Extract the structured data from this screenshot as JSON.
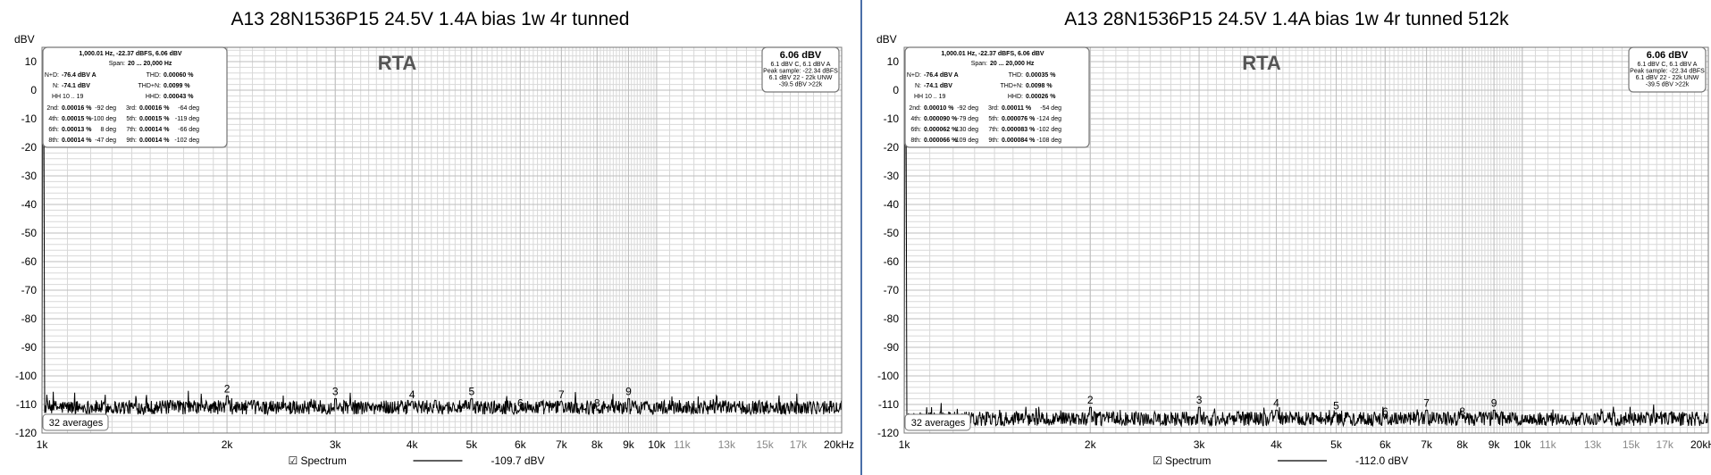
{
  "chart_data": [
    {
      "type": "line",
      "title": "A13 28N1536P15 24.5V 1.4A bias 1w 4r tunned",
      "ylabel": "dBV",
      "overlay_label": "RTA",
      "xscale": "log",
      "xlim": [
        1000,
        20000
      ],
      "ylim": [
        -120,
        15
      ],
      "x_ticks": [
        "1k",
        "2k",
        "3k",
        "4k",
        "5k",
        "6k",
        "7k",
        "8k",
        "9k",
        "10k",
        "11k",
        "13k",
        "15k",
        "17k",
        "20kHz"
      ],
      "y_ticks": [
        "10",
        "0",
        "-10",
        "-20",
        "-30",
        "-40",
        "-50",
        "-60",
        "-70",
        "-80",
        "-90",
        "-100",
        "-110",
        "-120"
      ],
      "grid": true,
      "legend": {
        "position": "bottom",
        "checkbox": "☑",
        "series_name": "Spectrum",
        "level": "-109.7 dBV"
      },
      "averages": "32 averages",
      "noise_floor_dBV": -111,
      "fundamental": {
        "freq_hz": 1000,
        "level_dBV": 6.06
      },
      "harmonics": [
        {
          "label": "2",
          "freq_hz": 2000,
          "level_dBV": -107
        },
        {
          "label": "3",
          "freq_hz": 3000,
          "level_dBV": -108
        },
        {
          "label": "4",
          "freq_hz": 4000,
          "level_dBV": -109
        },
        {
          "label": "5",
          "freq_hz": 5000,
          "level_dBV": -108
        },
        {
          "label": "6",
          "freq_hz": 6000,
          "level_dBV": -112
        },
        {
          "label": "7",
          "freq_hz": 7000,
          "level_dBV": -109
        },
        {
          "label": "8",
          "freq_hz": 8000,
          "level_dBV": -112
        },
        {
          "label": "9",
          "freq_hz": 9000,
          "level_dBV": -108
        }
      ],
      "stats_box": {
        "header": "1,000.01 Hz, -22.37 dBFS, 6.06 dBV",
        "span_label": "Span:",
        "span_value": "20 ... 20,000 Hz",
        "nd_label": "N+D:",
        "nd_value": "-76.4 dBV A",
        "thd_label": "THD:",
        "thd_value": "0.00060 %",
        "n_label": "N:",
        "n_value": "-74.1 dBV",
        "thdn_label": "THD+N:",
        "thdn_value": "0.0099 %",
        "hh_label": "HH 10 .. 19",
        "hhd_label": "HHD:",
        "hhd_value": "0.00043 %",
        "rows": [
          {
            "a_label": "2nd:",
            "a_val": "0.00016 %",
            "a_deg": "-92 deg",
            "b_label": "3rd:",
            "b_val": "0.00016 %",
            "b_deg": "-64 deg"
          },
          {
            "a_label": "4th:",
            "a_val": "0.00015 %",
            "a_deg": "-100 deg",
            "b_label": "5th:",
            "b_val": "0.00015 %",
            "b_deg": "-119 deg"
          },
          {
            "a_label": "6th:",
            "a_val": "0.00013 %",
            "a_deg": "8 deg",
            "b_label": "7th:",
            "b_val": "0.00014 %",
            "b_deg": "-66 deg"
          },
          {
            "a_label": "8th:",
            "a_val": "0.00014 %",
            "a_deg": "-47 deg",
            "b_label": "9th:",
            "b_val": "0.00014 %",
            "b_deg": "-102 deg"
          }
        ]
      },
      "level_box": {
        "big": "6.06 dBV",
        "lines": [
          "6.1 dBV C, 6.1 dBV A",
          "Peak sample: -22.34 dBFS",
          "6.1 dBV 22 - 22k UNW",
          "-39.5 dBV >22k"
        ]
      }
    },
    {
      "type": "line",
      "title": "A13 28N1536P15 24.5V 1.4A bias 1w 4r tunned 512k",
      "ylabel": "dBV",
      "overlay_label": "RTA",
      "xscale": "log",
      "xlim": [
        1000,
        20000
      ],
      "ylim": [
        -120,
        15
      ],
      "x_ticks": [
        "1k",
        "2k",
        "3k",
        "4k",
        "5k",
        "6k",
        "7k",
        "8k",
        "9k",
        "10k",
        "11k",
        "13k",
        "15k",
        "17k",
        "20kHz"
      ],
      "y_ticks": [
        "10",
        "0",
        "-10",
        "-20",
        "-30",
        "-40",
        "-50",
        "-60",
        "-70",
        "-80",
        "-90",
        "-100",
        "-110",
        "-120"
      ],
      "grid": true,
      "legend": {
        "position": "bottom",
        "checkbox": "☑",
        "series_name": "Spectrum",
        "level": "-112.0 dBV"
      },
      "averages": "32 averages",
      "noise_floor_dBV": -115,
      "fundamental": {
        "freq_hz": 1000,
        "level_dBV": 6.06
      },
      "harmonics": [
        {
          "label": "2",
          "freq_hz": 2000,
          "level_dBV": -111
        },
        {
          "label": "3",
          "freq_hz": 3000,
          "level_dBV": -111
        },
        {
          "label": "4",
          "freq_hz": 4000,
          "level_dBV": -112
        },
        {
          "label": "5",
          "freq_hz": 5000,
          "level_dBV": -113
        },
        {
          "label": "6",
          "freq_hz": 6000,
          "level_dBV": -115
        },
        {
          "label": "7",
          "freq_hz": 7000,
          "level_dBV": -112
        },
        {
          "label": "8",
          "freq_hz": 8000,
          "level_dBV": -115
        },
        {
          "label": "9",
          "freq_hz": 9000,
          "level_dBV": -112
        }
      ],
      "stats_box": {
        "header": "1,000.01 Hz, -22.37 dBFS, 6.06 dBV",
        "span_label": "Span:",
        "span_value": "20 ... 20,000 Hz",
        "nd_label": "N+D:",
        "nd_value": "-76.4 dBV A",
        "thd_label": "THD:",
        "thd_value": "0.00035 %",
        "n_label": "N:",
        "n_value": "-74.1 dBV",
        "thdn_label": "THD+N:",
        "thdn_value": "0.0098 %",
        "hh_label": "HH 10 .. 19",
        "hhd_label": "HHD:",
        "hhd_value": "0.00026 %",
        "rows": [
          {
            "a_label": "2nd:",
            "a_val": "0.00010 %",
            "a_deg": "-92 deg",
            "b_label": "3rd:",
            "b_val": "0.00011 %",
            "b_deg": "-54 deg"
          },
          {
            "a_label": "4th:",
            "a_val": "0.000090 %",
            "a_deg": "-79 deg",
            "b_label": "5th:",
            "b_val": "0.000076 %",
            "b_deg": "-124 deg"
          },
          {
            "a_label": "6th:",
            "a_val": "0.000062 %",
            "a_deg": "130 deg",
            "b_label": "7th:",
            "b_val": "0.000083 %",
            "b_deg": "-102 deg"
          },
          {
            "a_label": "8th:",
            "a_val": "0.000066 %",
            "a_deg": "-109 deg",
            "b_label": "9th:",
            "b_val": "0.000084 %",
            "b_deg": "-108 deg"
          }
        ]
      },
      "level_box": {
        "big": "6.06 dBV",
        "lines": [
          "6.1 dBV C, 6.1 dBV A",
          "Peak sample: -22.34 dBFS",
          "6.1 dBV 22 - 22k UNW",
          "-39.5 dBV >22k"
        ]
      }
    }
  ],
  "colors": {
    "spectrum": "#000000",
    "grid": "#d8d8d8",
    "frame": "#777777",
    "divider": "#4a6ea8"
  }
}
